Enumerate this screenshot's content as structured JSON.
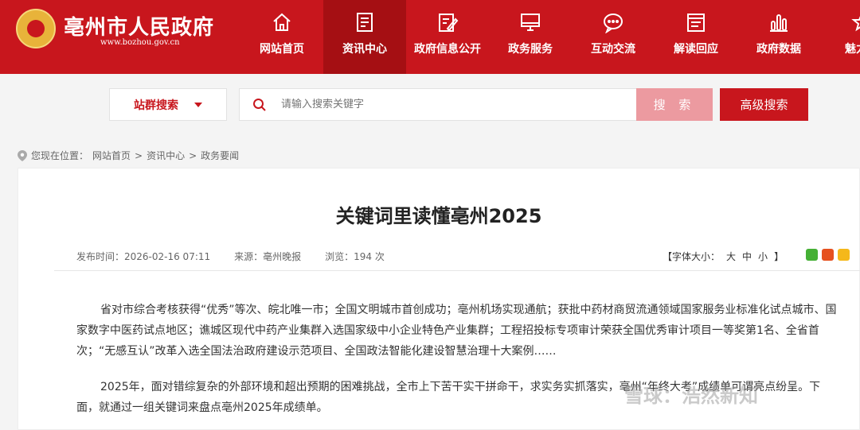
{
  "header": {
    "title": "亳州市人民政府",
    "url": "www.bozhou.gov.cn",
    "nav": [
      {
        "label": "网站首页",
        "icon": "home-icon"
      },
      {
        "label": "资讯中心",
        "icon": "news-icon",
        "active": true
      },
      {
        "label": "政府信息公开",
        "icon": "edit-icon"
      },
      {
        "label": "政务服务",
        "icon": "monitor-icon"
      },
      {
        "label": "互动交流",
        "icon": "chat-icon"
      },
      {
        "label": "解读回应",
        "icon": "document-icon"
      },
      {
        "label": "政府数据",
        "icon": "bar-chart-icon"
      },
      {
        "label": "魅力亳",
        "icon": "star-icon"
      }
    ]
  },
  "search": {
    "site_select": "站群搜索",
    "placeholder": "请输入搜索关键字",
    "search_label": "搜 索",
    "advanced_label": "高级搜索"
  },
  "breadcrumb": {
    "prefix": "您现在位置：",
    "items": [
      "网站首页",
      "资讯中心",
      "政务要闻"
    ],
    "separator": ">"
  },
  "article": {
    "title": "关键词里读懂亳州2025",
    "published": "发布时间：2026-02-16 07:11",
    "source": "来源：亳州晚报",
    "views": "浏览：194 次",
    "font_size_label": "【字体大小：",
    "font_large": "大",
    "font_medium": "中",
    "font_small": "小",
    "font_close": "】",
    "paragraphs": [
      "省对市综合考核获得“优秀”等次、皖北唯一市；全国文明城市首创成功；亳州机场实现通航；获批中药材商贸流通领域国家服务业标准化试点城市、国家数字中医药试点地区；谯城区现代中药产业集群入选国家级中小企业特色产业集群；工程招投标专项审计荣获全国优秀审计项目一等奖第1名、全省首次；“无感互认”改革入选全国法治政府建设示范项目、全国政法智能化建设智慧治理十大案例……",
      "2025年，面对错综复杂的外部环境和超出预期的困难挑战，全市上下苦干实干拼命干，求实务实抓落实，亳州“年终大考”成绩单可谓亮点纷呈。下面，就通过一组关键词来盘点亳州2025年成绩单。"
    ]
  },
  "watermark": "雪球：浩然新知",
  "colors": {
    "brand_red": "#c8161d",
    "dark_red": "#a50f13",
    "search_pink": "#ec9aa0"
  }
}
